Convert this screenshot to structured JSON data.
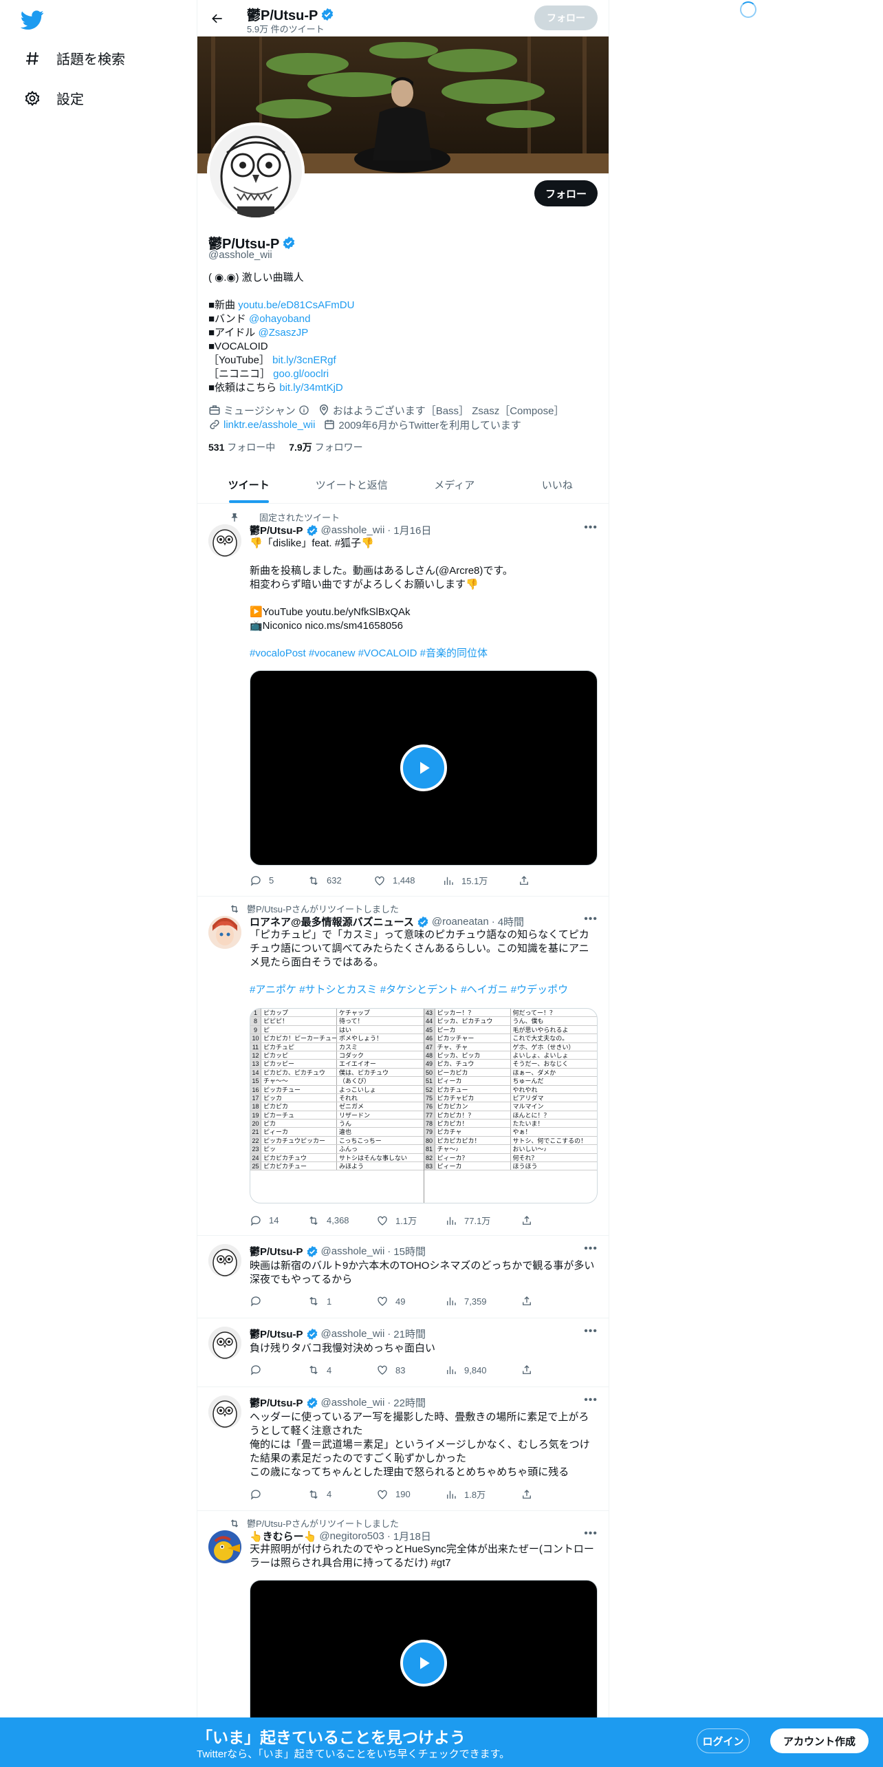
{
  "colors": {
    "accent": "#1d9bf0",
    "text": "#0f1419",
    "muted": "#536471"
  },
  "nav": {
    "explore_label": "話題を検索",
    "settings_label": "設定"
  },
  "topbar": {
    "name": "鬱P/Utsu-P",
    "tweet_count": "5.9万 件のツイート",
    "follow_label": "フォロー"
  },
  "profile": {
    "follow_label": "フォロー",
    "name": "鬱P/Utsu-P",
    "handle": "@asshole_wii",
    "bio": [
      {
        "text": "( ◉.◉) 激しい曲職人",
        "link": ""
      },
      {
        "text": "",
        "link": ""
      },
      {
        "text": "■新曲 ",
        "link": "youtu.be/eD81CsAFmDU"
      },
      {
        "text": "■バンド ",
        "link": "@ohayoband"
      },
      {
        "text": "■アイドル ",
        "link": "@ZsaszJP"
      },
      {
        "text": "■VOCALOID",
        "link": ""
      },
      {
        "text": "［YouTube］ ",
        "link": "bit.ly/3cnERgf"
      },
      {
        "text": "［ニコニコ］ ",
        "link": "goo.gl/ooclri"
      },
      {
        "text": "■依頼はこちら ",
        "link": "bit.ly/34mtKjD"
      }
    ],
    "category": "ミュージシャン",
    "location": "おはようございます［Bass］ Zsasz［Compose］",
    "website": "linktr.ee/asshole_wii",
    "joined": "2009年6月からTwitterを利用しています",
    "following_count": "531",
    "following_label": "フォロー中",
    "followers_count": "7.9万",
    "followers_label": "フォロワー"
  },
  "tabs": [
    "ツイート",
    "ツイートと返信",
    "メディア",
    "いいね"
  ],
  "tweets": [
    {
      "context": "固定されたツイート",
      "name": "鬱P/Utsu-P",
      "handle": "@asshole_wii",
      "time": "1月16日",
      "lines": [
        "👎「dislike」feat. #狐子👎",
        "",
        "新曲を投稿しました。動画はあるしさん(@Arcre8)です。",
        "相変わらず暗い曲ですがよろしくお願いします👎",
        "",
        "▶️YouTube youtu.be/yNfkSlBxQAk",
        "📺Niconico nico.ms/sm41658056",
        "",
        " #vocaloPost #vocanew #VOCALOID #音楽的同位体"
      ],
      "replies": "5",
      "retweets": "632",
      "likes": "1,448",
      "views": "15.1万"
    },
    {
      "context": "鬱P/Utsu-Pさんがリツイートしました",
      "name": "ロアネア@最多情報源バズニュース",
      "handle": "@roaneatan",
      "time": "4時間",
      "lines": [
        "「ピカチュピ」で「カスミ」って意味のピカチュウ語なの知らなくてピカ",
        "チュウ語について調べてみたらたくさんあるらしい。この知識を基にアニ",
        "メ見たら面白そうではある。",
        "",
        "#アニポケ #サトシとカスミ #タケシとデント #ヘイガニ #ウデッポウ"
      ],
      "table_left": [
        [
          "1",
          "ピカップ",
          "ケチャップ"
        ],
        [
          "8",
          "ピピピ！",
          "待って！"
        ],
        [
          "9",
          "ピ",
          "はい"
        ],
        [
          "10",
          "ピカピカ！ピーカーチュー",
          "ポメやしょう！"
        ],
        [
          "11",
          "ピカチュピ",
          "カスミ"
        ],
        [
          "12",
          "ピカッピ",
          "コダック"
        ],
        [
          "13",
          "ピカッピー",
          "エイエイオー"
        ],
        [
          "14",
          "ピカピカ、ピカチュウ",
          "僕は、ピカチュウ"
        ],
        [
          "15",
          "チャ〜〜",
          "（あくび）"
        ],
        [
          "16",
          "ピッカチュー",
          "よっこいしょ"
        ],
        [
          "17",
          "ピッカ",
          "それれ"
        ],
        [
          "18",
          "ピカピカ",
          "ゼニガメ"
        ],
        [
          "19",
          "ピカーチュ",
          "リザードン"
        ],
        [
          "20",
          "ピカ",
          "うん"
        ],
        [
          "21",
          "ピィーカ",
          "違也"
        ],
        [
          "22",
          "ピッカチュウピッカー",
          "こっちこっちー"
        ],
        [
          "23",
          "ピッ",
          "ふんっ"
        ],
        [
          "24",
          "ピカピカチュウ",
          "サトシはそんな事しない"
        ],
        [
          "25",
          "ピカピカチュー",
          "みほよう"
        ]
      ],
      "table_right": [
        [
          "43",
          "ピッカー！？",
          "何だってー！？"
        ],
        [
          "44",
          "ピッカ、ピカチュウ",
          "うん、僕も"
        ],
        [
          "45",
          "ピーカ",
          "毛が思いやられるよ"
        ],
        [
          "46",
          "ピカッチャー",
          "これで大丈夫なの。"
        ],
        [
          "47",
          "チャ、チャ",
          "ゲホ、ゲホ（せきい）"
        ],
        [
          "48",
          "ピッカ、ピッカ",
          "よいしょ、よいしょ"
        ],
        [
          "49",
          "ピカ、チュウ",
          "そうだー、おなじく"
        ],
        [
          "50",
          "ピーカピカ",
          "ほぁー、ダメか"
        ],
        [
          "51",
          "ピィーカ",
          "ちゅーんだ"
        ],
        [
          "52",
          "ピカチュー",
          "やれやれ"
        ],
        [
          "75",
          "ピカチャピカ",
          "ピアリダマ"
        ],
        [
          "76",
          "ピカピカン",
          "マルマイン"
        ],
        [
          "77",
          "ピカピカ！？",
          "ほんとに！？"
        ],
        [
          "78",
          "ピカピカ！",
          "たたいま！"
        ],
        [
          "79",
          "ピカチャ",
          "やぁ！"
        ],
        [
          "80",
          "ピカピカピカ！",
          "サトシ、何でここするの！"
        ],
        [
          "81",
          "チャ〜♪",
          "おいしい〜♪"
        ],
        [
          "82",
          "ピィーカ？",
          "何それ？"
        ],
        [
          "83",
          "ピィーカ",
          "ほうほう"
        ]
      ],
      "replies": "14",
      "retweets": "4,368",
      "likes": "1.1万",
      "views": "77.1万"
    },
    {
      "name": "鬱P/Utsu-P",
      "handle": "@asshole_wii",
      "time": "15時間",
      "lines": [
        "映画は新宿のバルト9か六本木のTOHOシネマズのどっちかで観る事が多い",
        "深夜でもやってるから"
      ],
      "replies": "",
      "retweets": "1",
      "likes": "49",
      "views": "7,359"
    },
    {
      "name": "鬱P/Utsu-P",
      "handle": "@asshole_wii",
      "time": "21時間",
      "lines": [
        "負け残りタバコ我慢対決めっちゃ面白い"
      ],
      "replies": "",
      "retweets": "4",
      "likes": "83",
      "views": "9,840"
    },
    {
      "name": "鬱P/Utsu-P",
      "handle": "@asshole_wii",
      "time": "22時間",
      "lines": [
        "ヘッダーに使っているアー写を撮影した時、畳敷きの場所に素足で上がろ",
        "うとして軽く注意された",
        "俺的には「畳＝武道場＝素足」というイメージしかなく、むしろ気をつけ",
        "た結果の素足だったのですごく恥ずかしかった",
        "この歳になってちゃんとした理由で怒られるとめちゃめちゃ頭に残る"
      ],
      "replies": "",
      "retweets": "4",
      "likes": "190",
      "views": "1.8万"
    },
    {
      "context": "鬱P/Utsu-Pさんがリツイートしました",
      "name": "👆きむらー👆",
      "handle": "@negitoro503",
      "time": "1月18日",
      "lines": [
        "天井照明が付けられたのでやっとHueSync完全体が出来たぜー(コントロー",
        "ラーは照らされ具合用に持ってるだけ) #gt7"
      ]
    }
  ],
  "bottombar": {
    "title": "「いま」起きていることを見つけよう",
    "subtitle": "Twitterなら、「いま」起きていることをいち早くチェックできます。",
    "login_label": "ログイン",
    "signup_label": "アカウント作成"
  }
}
